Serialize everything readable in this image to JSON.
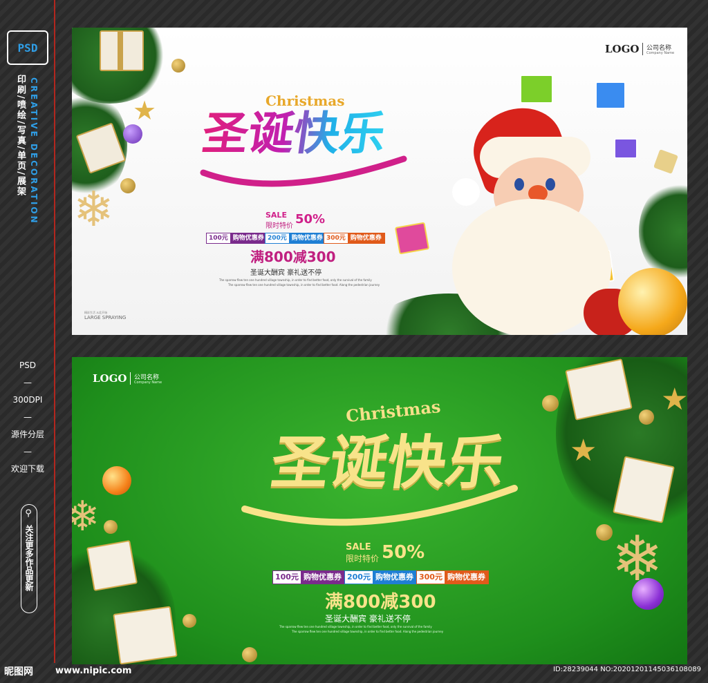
{
  "sidebar": {
    "badge": "PSD",
    "services": "印刷/喷绘/写真/单页/展架",
    "creative": "CREATIVE DECORATION",
    "specs": [
      "PSD",
      "300DPI",
      "源件分层",
      "欢迎下载"
    ],
    "dash": "—",
    "follow": "关注更多作品更新"
  },
  "banner_white": {
    "logo": "LOGO",
    "company_cn": "公司名称",
    "company_en": "Company Name",
    "title_en": "Christmas",
    "title_cn": "圣诞快乐",
    "sale": "SALE",
    "sale_sub": "限时特价",
    "sale_pct": "50%",
    "coupons": [
      {
        "amount": "100元",
        "label": "购物优惠券",
        "color": "#7a2b8c"
      },
      {
        "amount": "200元",
        "label": "购物优惠券",
        "color": "#1f7fd4"
      },
      {
        "amount": "300元",
        "label": "购物优惠券",
        "color": "#e05a1a"
      }
    ],
    "offer": "满800减300",
    "slogan": "圣诞大酬宾    豪礼送不停",
    "fine": "The sparrow flew ten one hundred village township, in order to find better food, only the survival of the family",
    "fine2": "The sparrow flew ten one hundred village township, in order to find better food. Along the pedestrian journey",
    "spray_small": "精彩生活 从此开始",
    "spray": "LARGE SPRAYING"
  },
  "banner_green": {
    "logo": "LOGO",
    "company_cn": "公司名称",
    "company_en": "Company Name",
    "title_en": "Christmas",
    "title_cn": "圣诞快乐",
    "sale": "SALE",
    "sale_sub": "限时特价",
    "sale_pct": "50%",
    "coupons": [
      {
        "amount": "100元",
        "label": "购物优惠券",
        "color": "#7a2b8c"
      },
      {
        "amount": "200元",
        "label": "购物优惠券",
        "color": "#1f7fd4"
      },
      {
        "amount": "300元",
        "label": "购物优惠券",
        "color": "#e05a1a"
      }
    ],
    "offer": "满800减300",
    "slogan": "圣诞大酬宾    豪礼送不停",
    "fine": "The sparrow flew ten one hundred village township, in order to find better food, only the survival of the family",
    "fine2": "The sparrow flew ten one hundred village township, in order to find better food. Along the pedestrian journey"
  },
  "footer": {
    "site_name": "昵图网",
    "url": "www.nipic.com",
    "id": "ID:28239044 NO:20201201145036108089"
  }
}
